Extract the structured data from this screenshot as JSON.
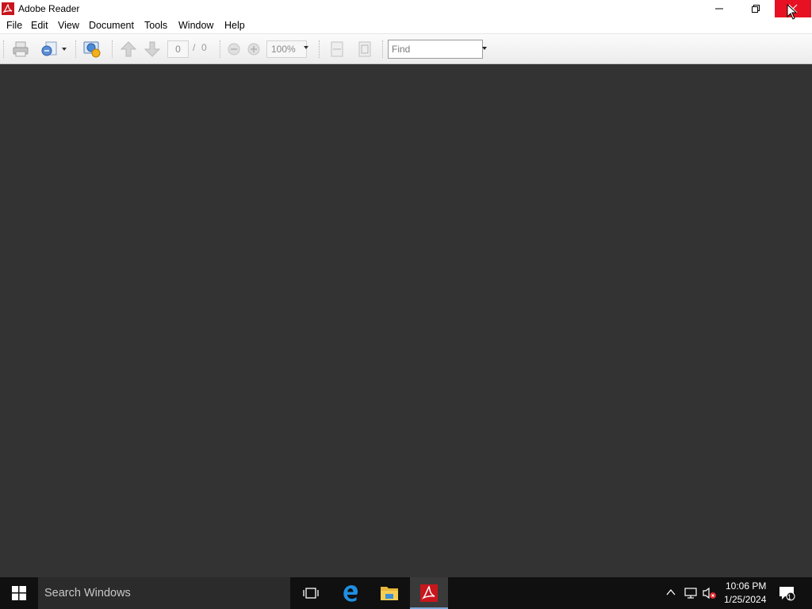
{
  "window": {
    "title": "Adobe Reader",
    "controls": {
      "minimize": "minimize",
      "maximize": "restore",
      "close": "close"
    }
  },
  "menubar": {
    "items": [
      "File",
      "Edit",
      "View",
      "Document",
      "Tools",
      "Window",
      "Help"
    ]
  },
  "toolbar": {
    "page_current": "0",
    "page_separator": "/",
    "page_total": "0",
    "zoom": "100%",
    "find_placeholder": "Find",
    "icons": [
      "print-icon",
      "share-icon",
      "collaborate-icon",
      "previous-page-icon",
      "next-page-icon",
      "zoom-out-icon",
      "zoom-in-icon",
      "fit-width-icon",
      "fit-page-icon"
    ]
  },
  "taskbar": {
    "search_placeholder": "Search Windows",
    "apps": [
      "task-view-icon",
      "edge-icon",
      "file-explorer-icon",
      "adobe-reader-icon"
    ],
    "clock": {
      "time": "10:06 PM",
      "date": "1/25/2024"
    },
    "notification_count": "1"
  },
  "colors": {
    "close_button": "#e81123",
    "document_background": "#333333",
    "taskbar": "#101010",
    "adobe_red": "#c8161d"
  }
}
